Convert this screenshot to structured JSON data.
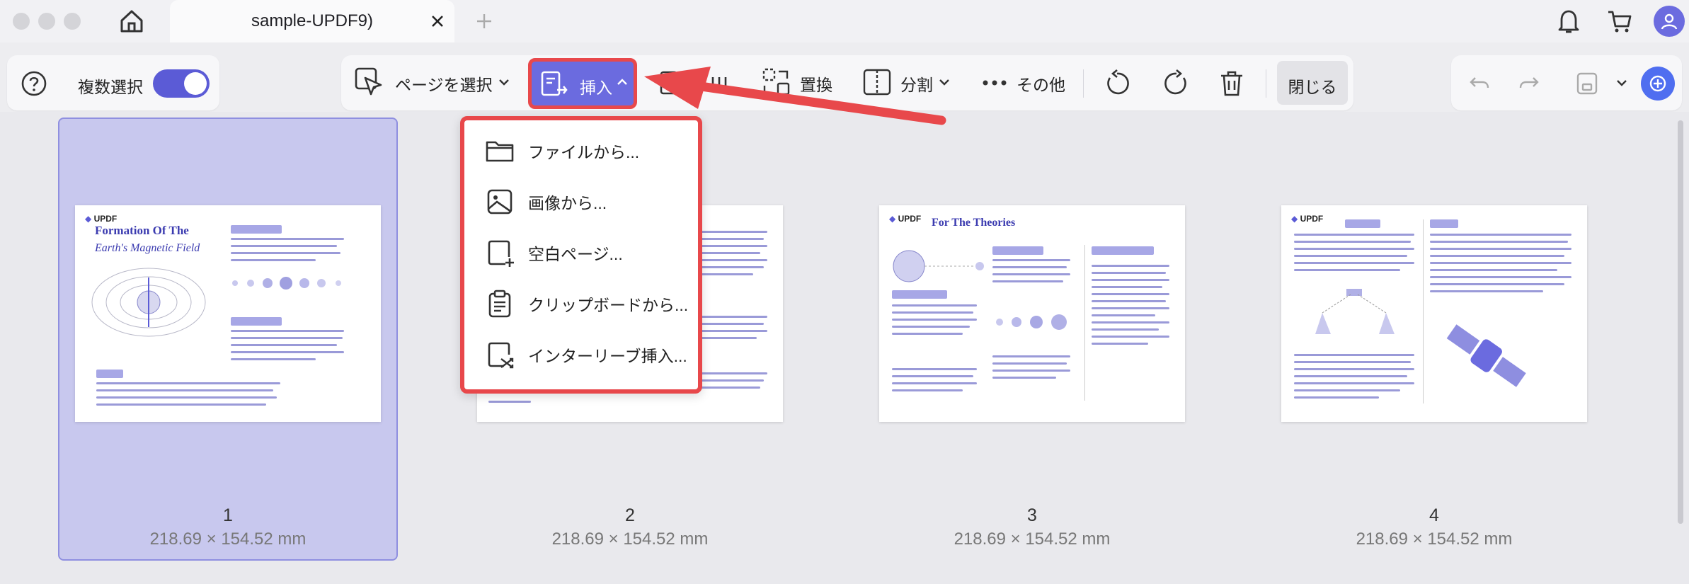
{
  "titlebar": {
    "tab_title": "sample-UPDF9)",
    "icons": [
      "home-icon",
      "close-icon",
      "plus-icon",
      "bell-icon",
      "cart-icon",
      "user-icon"
    ]
  },
  "toolbar": {
    "help_icon": "question-icon",
    "multi_select_label": "複数選択",
    "multi_select_on": true,
    "select_pages_label": "ページを選択",
    "insert_label": "挿入",
    "replace_label": "置換",
    "split_label": "分割",
    "more_label": "その他",
    "close_label": "閉じる",
    "accent": "#5b5bd6",
    "highlight": "#e8484b"
  },
  "insert_menu": {
    "items": [
      {
        "label": "ファイルから...",
        "icon": "folder-icon"
      },
      {
        "label": "画像から...",
        "icon": "image-icon"
      },
      {
        "label": "空白ページ...",
        "icon": "blank-page-icon"
      },
      {
        "label": "クリップボードから...",
        "icon": "clipboard-icon"
      },
      {
        "label": "インターリーブ挿入...",
        "icon": "interleave-icon"
      }
    ]
  },
  "pages": [
    {
      "number": "1",
      "size": "218.69 × 154.52 mm",
      "title": "Formation Of The",
      "subtitle": "Earth's Magnetic Field",
      "selected": true
    },
    {
      "number": "2",
      "size": "218.69 × 154.52 mm",
      "selected": false
    },
    {
      "number": "3",
      "size": "218.69 × 154.52 mm",
      "title": "For The Theories",
      "selected": false
    },
    {
      "number": "4",
      "size": "218.69 × 154.52 mm",
      "selected": false
    }
  ],
  "logo_text": "UPDF"
}
